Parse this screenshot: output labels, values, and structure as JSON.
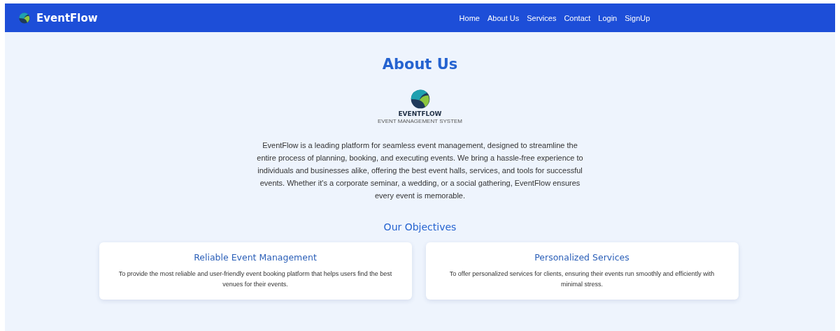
{
  "navbar": {
    "brand": "EventFlow",
    "links": [
      "Home",
      "About Us",
      "Services",
      "Contact",
      "Login",
      "SignUp"
    ]
  },
  "about": {
    "title": "About Us",
    "logo_text": "EVENTFLOW",
    "logo_tagline": "EVENT MANAGEMENT SYSTEM",
    "description": "EventFlow is a leading platform for seamless event management, designed to streamline the entire process of planning, booking, and executing events. We bring a hassle-free experience to individuals and businesses alike, offering the best event halls, services, and tools for successful events. Whether it's a corporate seminar, a wedding, or a social gathering, EventFlow ensures every event is memorable."
  },
  "objectives": {
    "title": "Our Objectives",
    "cards": [
      {
        "title": "Reliable Event Management",
        "text": "To provide the most reliable and user-friendly event booking platform that helps users find the best venues for their events."
      },
      {
        "title": "Personalized Services",
        "text": "To offer personalized services for clients, ensuring their events run smoothly and efficiently with minimal stress."
      }
    ]
  }
}
